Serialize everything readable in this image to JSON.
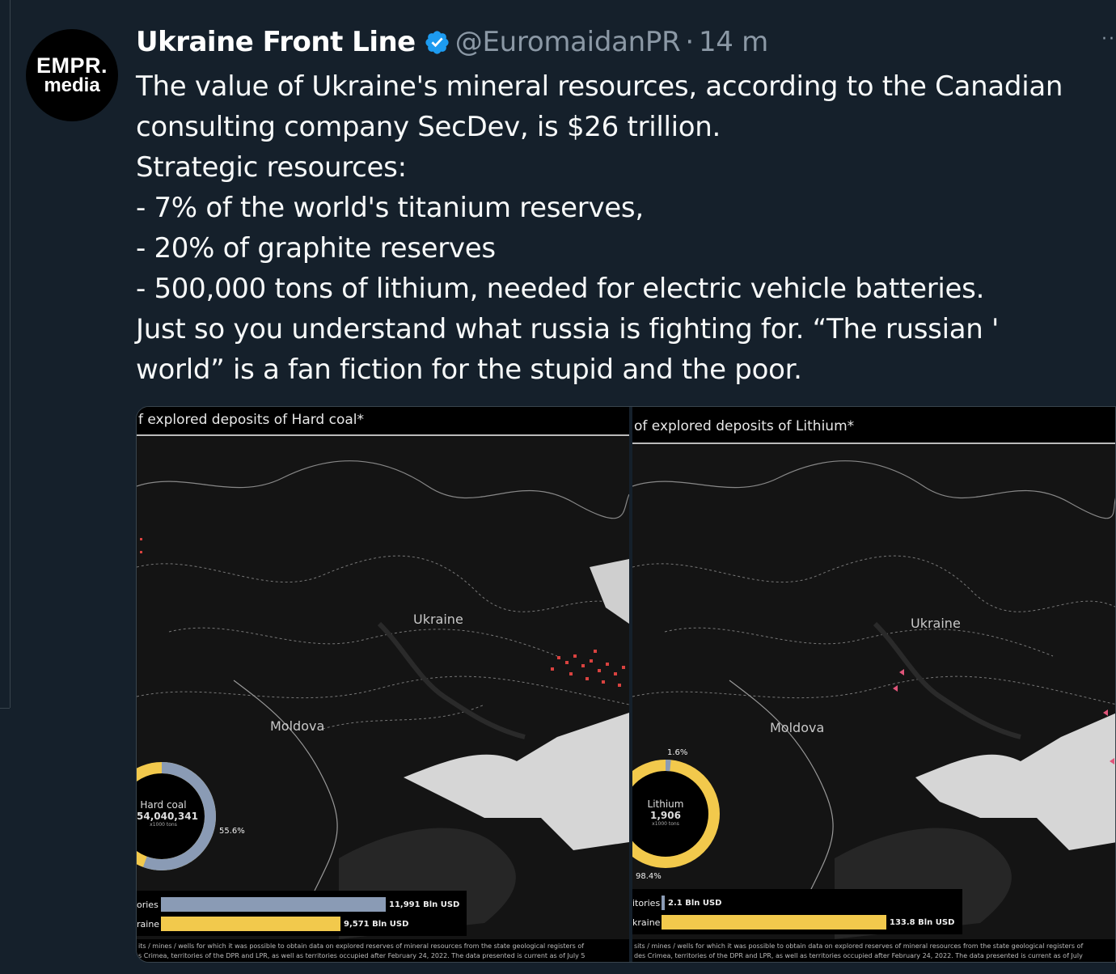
{
  "tweet": {
    "avatar_line1": "EMPR.",
    "avatar_line2": "media",
    "display_name": "Ukraine Front Line",
    "handle": "@EuromaidanPR",
    "separator": "·",
    "time": "14 m",
    "more": "··",
    "text_lines": [
      "The value of Ukraine's mineral resources, according to the Canadian",
      "consulting company SecDev, is $26 trillion.",
      "Strategic resources:",
      "- 7% of the world's titanium reserves,",
      "- 20% of graphite reserves",
      "- 500,000 tons of lithium, needed for electric vehicle batteries.",
      "Just so you understand what russia is fighting for. “The russian '",
      "world” is a fan fiction for the stupid and the poor."
    ]
  },
  "media": {
    "left": {
      "title": "f explored deposits of Hard coal*",
      "label_ukraine": "Ukraine",
      "label_moldova": "Moldova",
      "donut_name": "Hard coal",
      "donut_value": "54,040,341",
      "donut_unit": "x1000 tons",
      "pct_main": "55.6%",
      "bar1_label": "ories",
      "bar1_value": "11,991 Bln USD",
      "bar2_label": "raine",
      "bar2_value": "9,571 Bln USD",
      "footnote1": "its / mines / wells for which it was possible to obtain data on explored reserves of mineral resources from the state geological registers of",
      "footnote2": "s Crimea, territories of the DPR and LPR, as well as territories occupied after February 24, 2022. The data presented is current as of July 5"
    },
    "right": {
      "title": "of explored deposits of Lithium*",
      "label_ukraine": "Ukraine",
      "label_moldova": "Moldova",
      "donut_name": "Lithium",
      "donut_value": "1,906",
      "donut_unit": "x1000 tons",
      "pct_top": "1.6%",
      "pct_main": "98.4%",
      "bar1_label": "itories",
      "bar1_value": "2.1 Bln USD",
      "bar2_label": "kraine",
      "bar2_value": "133.8 Bln USD",
      "footnote1": "sits / mines / wells for which it was possible to obtain data on explored reserves of mineral resources from the state geological registers of",
      "footnote2": "des Crimea, territories of the DPR and LPR, as well as territories occupied after February 24, 2022. The data presented is current as of July"
    },
    "colors": {
      "occupied": "#8a9bb5",
      "ukraine": "#f2c94c",
      "deposit_coal": "#d9423f",
      "deposit_lithium": "#e0557a"
    }
  }
}
